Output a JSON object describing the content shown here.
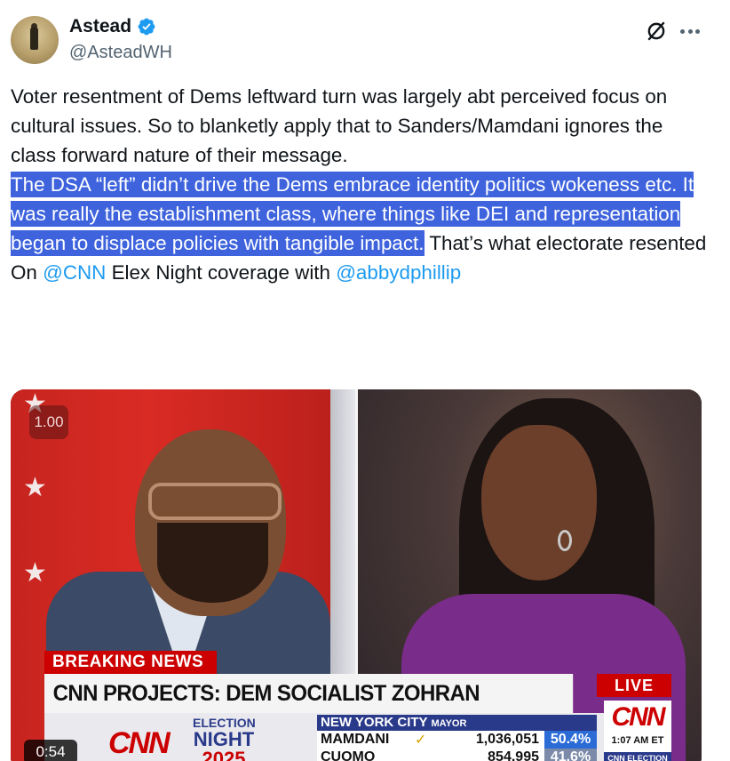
{
  "author": {
    "name": "Astead",
    "handle": "@AsteadWH",
    "verified_icon": "verified-badge-icon"
  },
  "actions": {
    "grok_icon": "grok-icon",
    "more_icon": "more-icon"
  },
  "tweet": {
    "para1": "Voter resentment of Dems leftward turn was largely abt perceived focus on cultural issues. So to blanketly apply that to Sanders/Mamdani ignores the class forward nature of their message.",
    "para2_highlighted": "The DSA “left” didn’t drive the Dems embrace identity politics wokeness etc. It was really the establishment class, where things like DEI and representation began to displace policies with tangible impact.",
    "para2_rest": " That’s what electorate resented",
    "para3_prefix": "On ",
    "para3_mention1": "@CNN",
    "para3_middle": " Elex Night coverage with ",
    "para3_mention2": "@abbydphillip"
  },
  "video": {
    "speed": "1.00",
    "timestamp": "0:54",
    "breaking": "BREAKING NEWS",
    "headline": "CNN PROJECTS: DEM SOCIALIST ZOHRAN MAMDANI WILL BE NYC MAYOR",
    "live": "LIVE",
    "logo": "CNN",
    "election_line1": "ELECTION",
    "election_line2": "NIGHT",
    "election_year": "2025",
    "results_title": "NEW YORK CITY",
    "results_subtitle": "MAYOR",
    "candidates": [
      {
        "name": "MAMDANI",
        "votes": "1,036,051",
        "pct": "50.4%"
      },
      {
        "name": "CUOMO",
        "votes": "854,995",
        "pct": "41.6%"
      }
    ],
    "time": "1:07 AM ET",
    "footer": "CNN ELECTION"
  },
  "colors": {
    "highlight": "#3e63dd",
    "link": "#1d9bf0",
    "secondary_text": "#536471",
    "cnn_red": "#cc0000"
  }
}
